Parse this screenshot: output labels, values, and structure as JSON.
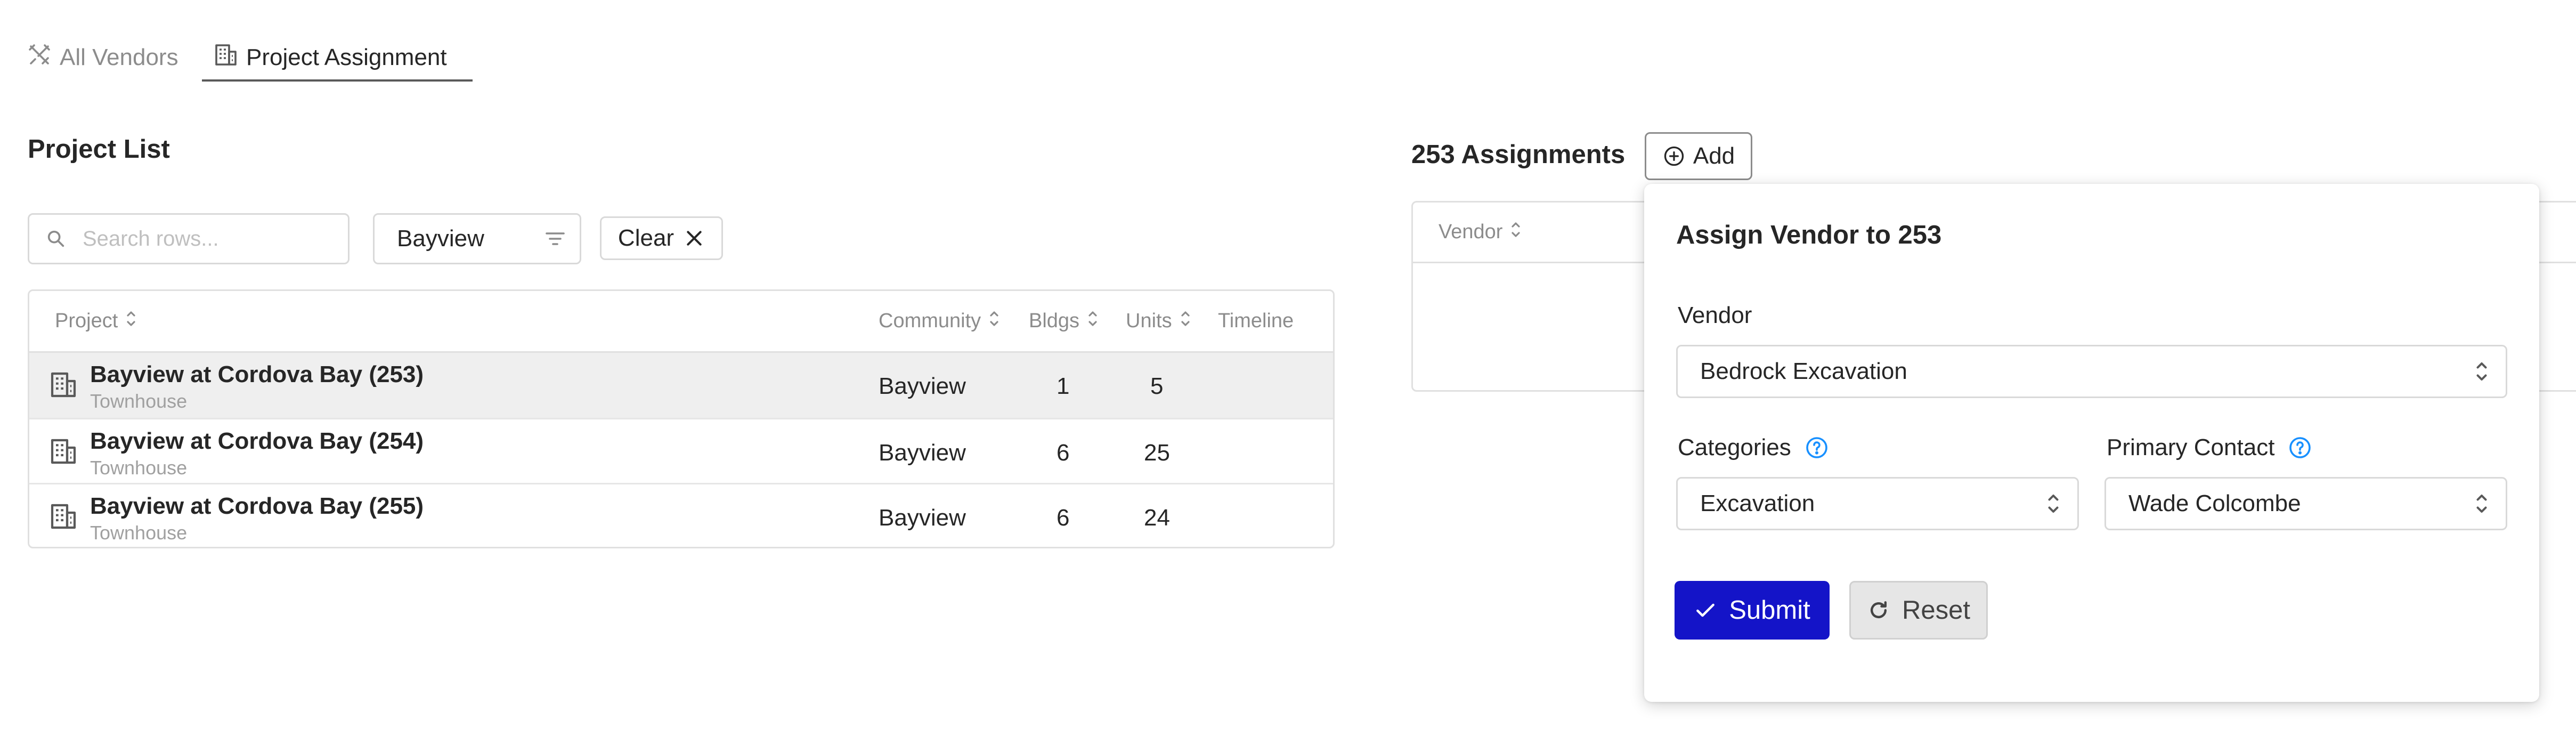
{
  "tabs": [
    {
      "label": "All Vendors",
      "icon": "tools-icon",
      "active": false
    },
    {
      "label": "Project Assignment",
      "icon": "building-icon",
      "active": true
    }
  ],
  "project_list": {
    "title": "Project List",
    "search_placeholder": "Search rows...",
    "filter_value": "Bayview",
    "clear_label": "Clear",
    "columns": [
      "Project",
      "Community",
      "Bldgs",
      "Units",
      "Timeline"
    ],
    "rows": [
      {
        "name": "Bayview at Cordova Bay (253)",
        "type": "Townhouse",
        "community": "Bayview",
        "bldgs": "1",
        "units": "5",
        "timeline": "",
        "selected": true
      },
      {
        "name": "Bayview at Cordova Bay (254)",
        "type": "Townhouse",
        "community": "Bayview",
        "bldgs": "6",
        "units": "25",
        "timeline": "",
        "selected": false
      },
      {
        "name": "Bayview at Cordova Bay (255)",
        "type": "Townhouse",
        "community": "Bayview",
        "bldgs": "6",
        "units": "24",
        "timeline": "",
        "selected": false
      }
    ]
  },
  "assignments": {
    "title": "253 Assignments",
    "add_label": "Add",
    "columns": [
      "Vendor"
    ]
  },
  "assign_form": {
    "title": "Assign Vendor to 253",
    "vendor_label": "Vendor",
    "vendor_value": "Bedrock Excavation",
    "categories_label": "Categories",
    "categories_value": "Excavation",
    "contact_label": "Primary Contact",
    "contact_value": "Wade Colcombe",
    "submit_label": "Submit",
    "reset_label": "Reset"
  },
  "colors": {
    "primary": "#1414c8",
    "help": "#1890ff",
    "selected_row": "#efefef"
  }
}
